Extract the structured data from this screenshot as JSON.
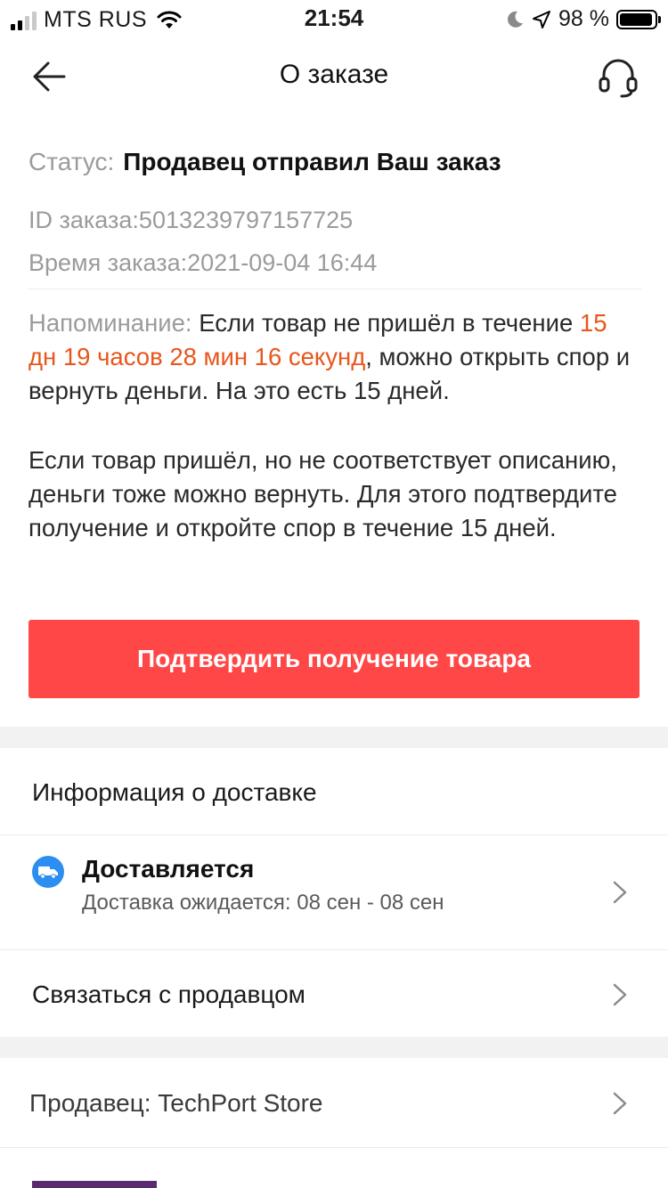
{
  "status_bar": {
    "carrier": "MTS RUS",
    "time": "21:54",
    "battery_percent": "98 %",
    "battery_level": 0.98
  },
  "nav": {
    "title": "О заказе",
    "back_icon": "arrow-left-icon",
    "support_icon": "headset-icon"
  },
  "order": {
    "status_label": "Статус:",
    "status_value": "Продавец отправил Ваш заказ",
    "id_label": "ID заказа:",
    "id_value": "5013239797157725",
    "time_label": "Время заказа:",
    "time_value": "2021-09-04 16:44"
  },
  "reminder": {
    "label": "Напоминание:",
    "text_before": "Если товар не пришёл в течение",
    "countdown": "15 дн 19 часов 28 мин 16 секунд",
    "text_after": ", можно открыть спор и вернуть деньги. На это есть 15 дней.",
    "paragraph2": "Если товар пришёл, но не соответствует описанию, деньги тоже можно вернуть. Для этого подтвердите получение и откройте спор в течение 15 дней."
  },
  "confirm_button": "Подтвердить получение товара",
  "delivery": {
    "section_title": "Информация о доставке",
    "status": "Доставляется",
    "expected": "Доставка ожидается: 08 сен - 08 сен"
  },
  "contact_seller": "Связаться с продавцом",
  "seller": {
    "label": "Продавец: TechPort Store"
  },
  "colors": {
    "accent": "#e8561d",
    "button": "#ff4747",
    "delivery_icon": "#2b8ef0"
  }
}
